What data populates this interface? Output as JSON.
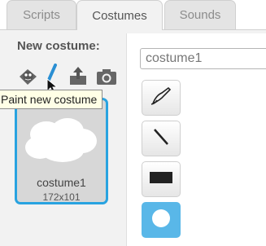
{
  "tabs": [
    {
      "label": "Scripts",
      "active": false
    },
    {
      "label": "Costumes",
      "active": true
    },
    {
      "label": "Sounds",
      "active": false
    }
  ],
  "new_costume": {
    "label": "New costume:",
    "icons": [
      "choose-from-library-icon",
      "paint-brush-icon",
      "upload-file-icon",
      "camera-icon"
    ]
  },
  "tooltip": "Paint new costume",
  "costume": {
    "name": "costume1",
    "size": "172x101"
  },
  "editor": {
    "name_value": "costume1",
    "tools": [
      "paintbrush-tool-icon",
      "line-tool-icon",
      "rectangle-tool-icon",
      "ellipse-tool-icon"
    ],
    "selected_tool": "ellipse-tool-icon"
  },
  "colors": {
    "accent": "#29a3e0",
    "selected_tool": "#59b7e8"
  }
}
